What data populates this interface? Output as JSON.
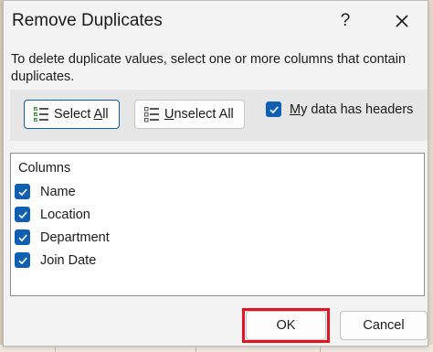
{
  "dialog": {
    "title": "Remove Duplicates",
    "help_label": "?",
    "description": "To delete duplicate values, select one or more columns that contain duplicates."
  },
  "toolbar": {
    "select_all": {
      "mnemonic": "",
      "pre": "Select ",
      "key": "A",
      "post": "ll"
    },
    "unselect_all": {
      "pre": "",
      "key": "U",
      "post": "nselect All"
    },
    "headers": {
      "key": "M",
      "post": "y data has headers",
      "checked": true
    }
  },
  "columns": {
    "label": "Columns",
    "items": [
      {
        "label": "Name",
        "checked": true
      },
      {
        "label": "Location",
        "checked": true
      },
      {
        "label": "Department",
        "checked": true
      },
      {
        "label": "Join Date",
        "checked": true
      }
    ]
  },
  "footer": {
    "ok_label": "OK",
    "cancel_label": "Cancel"
  },
  "colors": {
    "accent": "#0f5fb3",
    "highlight": "#e1151f"
  }
}
